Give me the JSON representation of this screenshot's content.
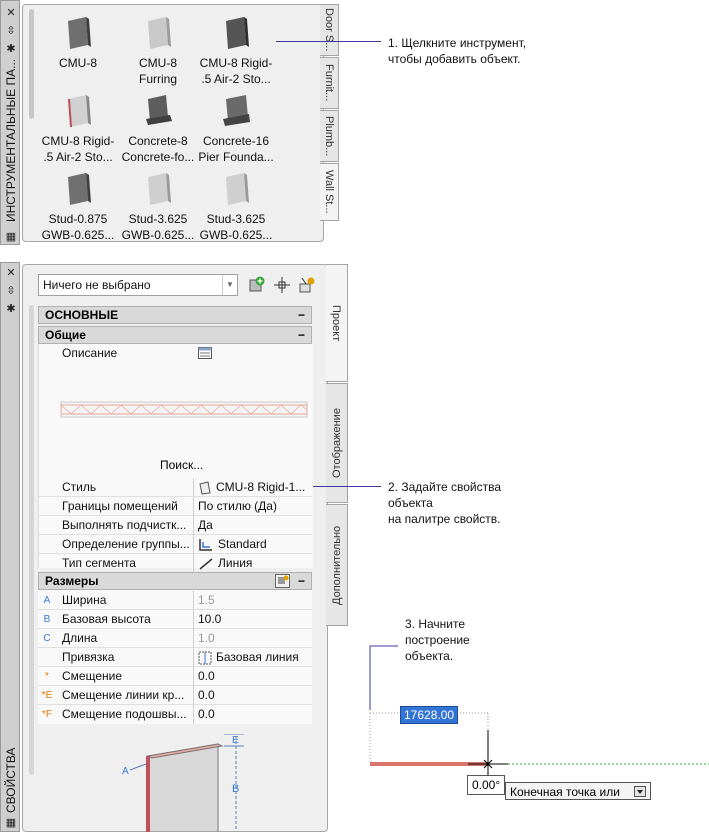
{
  "tool_palette": {
    "title": "ИНСТРУМЕНТАЛЬНЫЕ ПА...",
    "tools": [
      {
        "label1": "CMU-8",
        "label2": ""
      },
      {
        "label1": "CMU-8",
        "label2": "Furring"
      },
      {
        "label1": "CMU-8 Rigid-",
        "label2": ".5 Air-2 Sto..."
      },
      {
        "label1": "CMU-8 Rigid-",
        "label2": ".5 Air-2 Sto..."
      },
      {
        "label1": "Concrete-8",
        "label2": "Concrete-fo..."
      },
      {
        "label1": "Concrete-16",
        "label2": "Pier Founda..."
      },
      {
        "label1": "Stud-0.875",
        "label2": "GWB-0.625..."
      },
      {
        "label1": "Stud-3.625",
        "label2": "GWB-0.625..."
      },
      {
        "label1": "Stud-3.625",
        "label2": "GWB-0.625..."
      }
    ],
    "tabs": [
      "Door S...",
      "Furnit...",
      "Plumb...",
      "Wall St..."
    ]
  },
  "properties": {
    "title": "СВОЙСТВА",
    "selection": "Ничего не выбрано",
    "tabs": [
      "Проект",
      "Отображение",
      "Дополнительно"
    ],
    "cat_basic": "ОСНОВНЫЕ",
    "cat_general": "Общие",
    "description_label": "Описание",
    "search_link": "Поиск...",
    "general_rows": [
      {
        "k": "Стиль",
        "v": "CMU-8 Rigid-1..."
      },
      {
        "k": "Границы помещений",
        "v": "По стилю (Да)"
      },
      {
        "k": "Выполнять подчистк...",
        "v": "Да"
      },
      {
        "k": "Определение группы...",
        "v": "Standard"
      },
      {
        "k": "Тип сегмента",
        "v": "Линия"
      }
    ],
    "cat_dimensions": "Размеры",
    "dim_rows": [
      {
        "icon": "A",
        "k": "Ширина",
        "v": "1.5"
      },
      {
        "icon": "B",
        "k": "Базовая высота",
        "v": "10.0"
      },
      {
        "icon": "C",
        "k": "Длина",
        "v": "1.0"
      },
      {
        "icon": "",
        "k": "Привязка",
        "v": "Базовая линия"
      },
      {
        "icon": "*",
        "k": "Смещение",
        "v": "0.0"
      },
      {
        "icon": "*E",
        "k": "Смещение линии кр...",
        "v": "0.0"
      },
      {
        "icon": "*F",
        "k": "Смещение подошвы...",
        "v": "0.0"
      }
    ],
    "diagram_labels": {
      "a": "A",
      "b": "B",
      "e": "E"
    }
  },
  "annotations": {
    "step1_line1": "1. Щелкните инструмент,",
    "step1_line2": "чтобы добавить объект.",
    "step2_line1": "2. Задайте свойства",
    "step2_line2": "объекта",
    "step2_line3": "на палитре свойств.",
    "step3_line1": "3. Начните",
    "step3_line2": "построение",
    "step3_line3": "объекта."
  },
  "drawing": {
    "length_input": "17628.00",
    "angle": "0.00°",
    "prompt": "Конечная точка или"
  },
  "colors": {
    "accent_wall": "#d9756d",
    "leader": "#3a3aa0",
    "selection": "#3375d6"
  }
}
